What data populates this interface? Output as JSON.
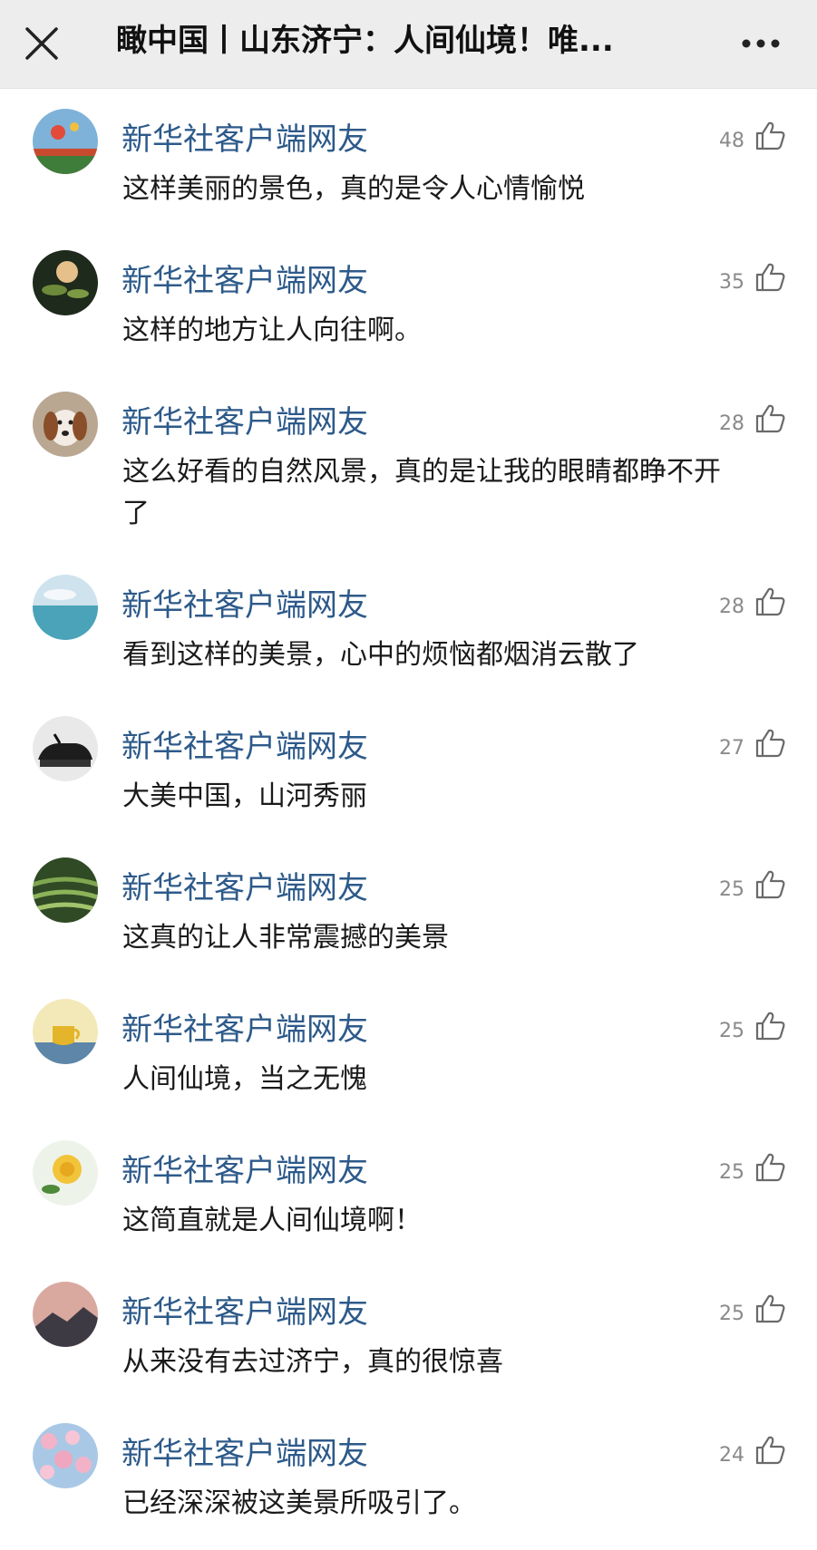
{
  "header": {
    "title": "瞰中国丨山东济宁：人间仙境！唯...",
    "close_icon": "close-icon",
    "more_icon": "more-dots-icon",
    "background": "#ededed"
  },
  "colors": {
    "username": "#2d5a8a",
    "text": "#1a1a1a",
    "count": "#8a8a8a"
  },
  "comments": [
    {
      "user": "新华社客户端网友",
      "likes": "48",
      "text": "这样美丽的景色，真的是令人心情愉悦"
    },
    {
      "user": "新华社客户端网友",
      "likes": "35",
      "text": "这样的地方让人向往啊。"
    },
    {
      "user": "新华社客户端网友",
      "likes": "28",
      "text": "这么好看的自然风景，真的是让我的眼睛都睁不开了"
    },
    {
      "user": "新华社客户端网友",
      "likes": "28",
      "text": "看到这样的美景，心中的烦恼都烟消云散了"
    },
    {
      "user": "新华社客户端网友",
      "likes": "27",
      "text": "大美中国，山河秀丽"
    },
    {
      "user": "新华社客户端网友",
      "likes": "25",
      "text": "这真的让人非常震撼的美景"
    },
    {
      "user": "新华社客户端网友",
      "likes": "25",
      "text": "人间仙境，当之无愧"
    },
    {
      "user": "新华社客户端网友",
      "likes": "25",
      "text": "这简直就是人间仙境啊！"
    },
    {
      "user": "新华社客户端网友",
      "likes": "25",
      "text": "从来没有去过济宁，真的很惊喜"
    },
    {
      "user": "新华社客户端网友",
      "likes": "24",
      "text": "已经深深被这美景所吸引了。"
    }
  ]
}
